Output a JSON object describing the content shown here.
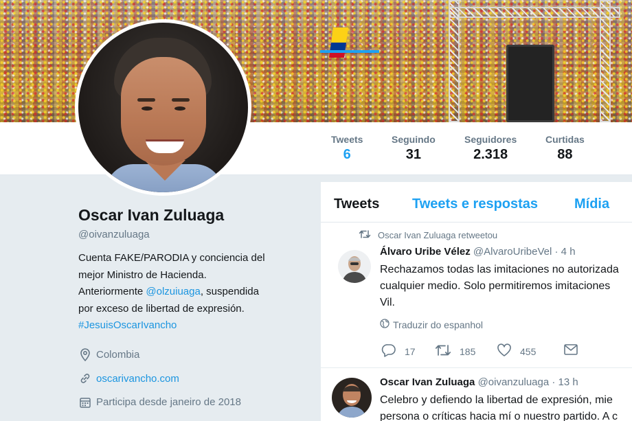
{
  "stats": [
    {
      "label": "Tweets",
      "value": "6"
    },
    {
      "label": "Seguindo",
      "value": "31"
    },
    {
      "label": "Seguidores",
      "value": "2.318"
    },
    {
      "label": "Curtidas",
      "value": "88"
    }
  ],
  "profile": {
    "name": "Oscar Ivan Zuluaga",
    "handle": "@oivanzuluaga",
    "bio_line1": "Cuenta FAKE/PARODIA y conciencia del",
    "bio_line2": "mejor Ministro de Hacienda.",
    "bio_line3_pre": "Anteriormente ",
    "bio_mention": "@olzuiuaga",
    "bio_line3_post": ", suspendida",
    "bio_line4": "por exceso de libertad de expresión.",
    "bio_hashtag": "#JesuisOscarIvancho",
    "location": "Colombia",
    "website": "oscarivancho.com",
    "joined": "Participa desde janeiro de 2018"
  },
  "timeline": {
    "tabs": [
      "Tweets",
      "Tweets e respostas",
      "Mídia"
    ],
    "tweets": [
      {
        "retweet_by": "Oscar Ivan Zuluaga retweetou",
        "author": "Álvaro Uribe Vélez",
        "handle": "@AlvaroUribeVel",
        "time": "· 4 h",
        "lines": [
          "Rechazamos todas las imitaciones no autorizada",
          "cualquier medio. Solo permitiremos imitaciones",
          "Vil."
        ],
        "translate": "Traduzir do espanhol",
        "replies": "17",
        "retweets": "185",
        "likes": "455"
      },
      {
        "author": "Oscar Ivan Zuluaga",
        "handle": "@oivanzuluaga",
        "time": "· 13 h",
        "lines": [
          "Celebro y defiendo la libertad de expresión, mie",
          "persona o críticas hacia mí o nuestro partido. A c"
        ]
      }
    ]
  },
  "colors": {
    "accent": "#1da1f2",
    "link": "#1b95e0",
    "muted": "#657786",
    "background": "#e6ecf0"
  }
}
